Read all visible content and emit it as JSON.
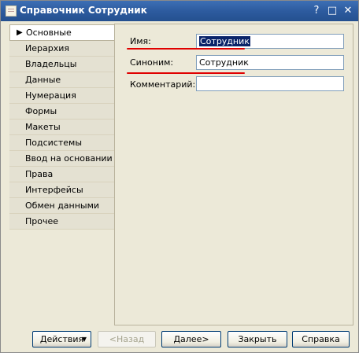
{
  "window": {
    "title": "Справочник Сотрудник",
    "buttons": [
      "?",
      "□",
      "✕"
    ]
  },
  "tabs": [
    {
      "label": "Основные",
      "active": true
    },
    {
      "label": "Иерархия"
    },
    {
      "label": "Владельцы"
    },
    {
      "label": "Данные"
    },
    {
      "label": "Нумерация"
    },
    {
      "label": "Формы"
    },
    {
      "label": "Макеты"
    },
    {
      "label": "Подсистемы"
    },
    {
      "label": "Ввод на основании"
    },
    {
      "label": "Права"
    },
    {
      "label": "Интерфейсы"
    },
    {
      "label": "Обмен данными"
    },
    {
      "label": "Прочее"
    }
  ],
  "form": {
    "name_label": "Имя:",
    "name_value": "Сотрудник",
    "synonym_label": "Синоним:",
    "synonym_value": "Сотрудник",
    "comment_label": "Комментарий:",
    "comment_value": ""
  },
  "footer": {
    "actions": "Действия",
    "back": "<Назад",
    "next": "Далее>",
    "close": "Закрыть",
    "help": "Справка"
  },
  "colors": {
    "titlebar": "#2d5b9f",
    "selection": "#0a246a",
    "annotation": "#e00000"
  }
}
